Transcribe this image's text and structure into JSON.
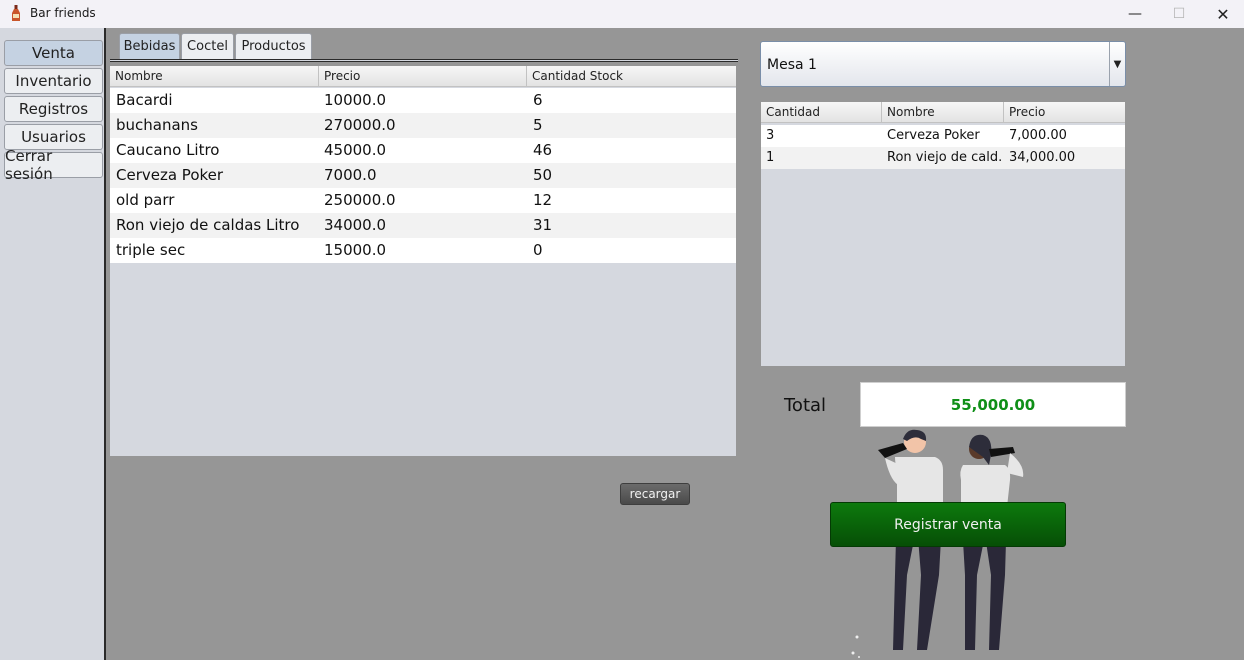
{
  "window": {
    "title": "Bar friends",
    "minimize_glyph": "—",
    "maximize_glyph": "☐",
    "close_glyph": "✕"
  },
  "nav": {
    "items": [
      {
        "label": "Venta",
        "active": true
      },
      {
        "label": "Inventario",
        "active": false
      },
      {
        "label": "Registros",
        "active": false
      },
      {
        "label": "Usuarios",
        "active": false
      },
      {
        "label": "Cerrar sesión",
        "active": false
      }
    ]
  },
  "tabs": [
    {
      "label": "Bebidas",
      "active": true
    },
    {
      "label": "Coctel",
      "active": false
    },
    {
      "label": "Productos",
      "active": false
    }
  ],
  "products_table": {
    "columns": [
      "Nombre",
      "Precio",
      "Cantidad Stock"
    ],
    "rows": [
      [
        "Bacardi",
        "10000.0",
        "6"
      ],
      [
        "buchanans",
        "270000.0",
        "5"
      ],
      [
        "Caucano Litro",
        "45000.0",
        "46"
      ],
      [
        "Cerveza Poker",
        "7000.0",
        "50"
      ],
      [
        "old parr",
        "250000.0",
        "12"
      ],
      [
        "Ron viejo de caldas Litro",
        "34000.0",
        "31"
      ],
      [
        "triple sec",
        "15000.0",
        "0"
      ]
    ]
  },
  "reload_label": "recargar",
  "mesa_select": {
    "value": "Mesa 1",
    "arrow": "▼"
  },
  "order_table": {
    "columns": [
      "Cantidad",
      "Nombre",
      "Precio"
    ],
    "rows": [
      [
        "3",
        "Cerveza Poker",
        "7,000.00"
      ],
      [
        "1",
        "Ron viejo de cald...",
        "34,000.00"
      ]
    ]
  },
  "total": {
    "label": "Total",
    "value": "55,000.00"
  },
  "register_label": "Registrar venta",
  "colors": {
    "background": "#969696",
    "total_text": "#0f8f17",
    "register_button": "#0a6b0a",
    "selected": "#c5d2e2"
  }
}
